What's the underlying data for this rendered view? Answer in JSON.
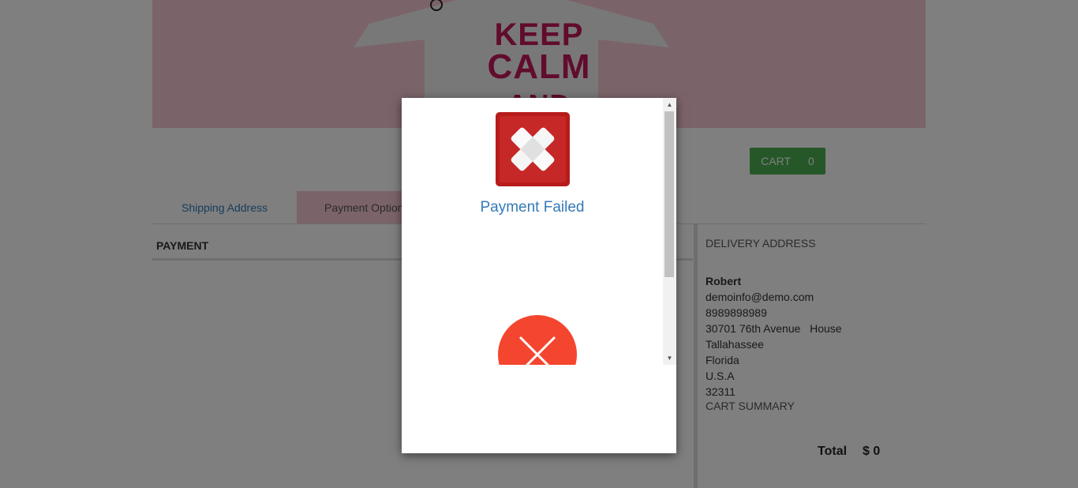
{
  "banner": {
    "line1": "KEEP",
    "line2": "CALM",
    "line3": "AND"
  },
  "cart": {
    "label": "CART",
    "count": "0"
  },
  "tabs": {
    "shipping": "Shipping Address",
    "payment": "Payment Option"
  },
  "payment_section": {
    "title": "PAYMENT"
  },
  "delivery": {
    "title": "DELIVERY ADDRESS",
    "name": "Robert",
    "email": "demoinfo@demo.com",
    "phone": "8989898989",
    "street": "30701 76th Avenue   House",
    "city": "Tallahassee",
    "state": "Florida",
    "country": "U.S.A",
    "zip": "32311"
  },
  "cart_summary": {
    "title": "CART SUMMARY",
    "total_label": "Total",
    "total_value": "$ 0"
  },
  "modal": {
    "message": "Payment Failed",
    "icon_primary": "x-bandage-icon",
    "icon_secondary": "x-circle-icon"
  },
  "colors": {
    "accent_link": "#337ab7",
    "cart_green": "#4caf50",
    "banner_pink": "#f7c9d3",
    "fail_red": "#b71c1c",
    "fail_orange": "#f44336"
  }
}
